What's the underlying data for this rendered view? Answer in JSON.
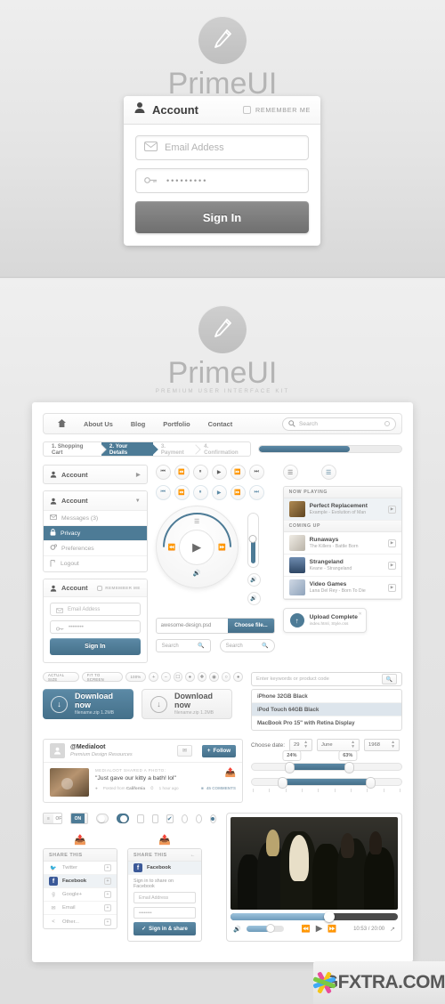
{
  "brand": {
    "name": "PrimeUI",
    "tagline": "PREMIUM USER INTERFACE KIT",
    "logo_icon": "pencil-icon",
    "accent_color": "#4d7b96",
    "grey_button_color": "#7f7f7f"
  },
  "login_hero": {
    "title": "Account",
    "account_icon": "user-icon",
    "remember_label": "REMEMBER ME",
    "email_placeholder": "Email Addess",
    "email_icon": "envelope-icon",
    "password_value": "•••••••••",
    "password_icon": "key-icon",
    "signin_label": "Sign In"
  },
  "nav": {
    "home_icon": "home-icon",
    "items": [
      "About Us",
      "Blog",
      "Portfolio",
      "Contact"
    ],
    "search_placeholder": "Search",
    "search_icon": "search-icon",
    "clear_icon": "close-circle-icon"
  },
  "checkout": {
    "steps": [
      {
        "label": "1. Shopping Cart",
        "state": "done"
      },
      {
        "label": "2. Your Details",
        "state": "active"
      },
      {
        "label": "3. Payment",
        "state": "todo"
      },
      {
        "label": "4. Confirmation",
        "state": "todo"
      }
    ],
    "progress_percent": 64
  },
  "accordion": {
    "collapsed_label": "Account",
    "expanded_label": "Account",
    "items": [
      {
        "label": "Messages (3)",
        "icon": "envelope-icon",
        "selected": false
      },
      {
        "label": "Privacy",
        "icon": "lock-icon",
        "selected": true
      },
      {
        "label": "Preferences",
        "icon": "gear-icon",
        "selected": false
      },
      {
        "label": "Logout",
        "icon": "exit-icon",
        "selected": false
      }
    ]
  },
  "login_small": {
    "title": "Account",
    "remember_label": "REMEMBER ME",
    "email_placeholder": "Email Addess",
    "password_value": "••••••••",
    "signin_label": "Sign In"
  },
  "transport": {
    "buttons": [
      "prev-track-icon",
      "rewind-icon",
      "pause-icon",
      "play-icon",
      "fast-forward-icon",
      "next-track-icon"
    ],
    "glyphs": [
      "⏮",
      "⏪",
      "⏸",
      "▶",
      "⏩",
      "⏭"
    ]
  },
  "clickwheel": {
    "menu_icon": "menu-list-icon",
    "prev_icon": "rewind-icon",
    "next_icon": "fast-forward-icon",
    "volume_icon": "volume-icon",
    "center_icon": "play-icon"
  },
  "volume": {
    "level_percent": 45,
    "speaker_icon": "volume-icon"
  },
  "view_toggles": [
    {
      "icon": "list-view-icon",
      "active": false
    },
    {
      "icon": "list-view-icon",
      "active": true
    }
  ],
  "playlist": {
    "now_playing_header": "NOW PLAYING",
    "coming_up_header": "COMING UP",
    "now_playing": {
      "title": "Perfect Replacement",
      "subtitle": "Example - Evolution of Man",
      "art_color": "#8a6b3f",
      "action_icon": "add-icon"
    },
    "coming_up": [
      {
        "title": "Runaways",
        "subtitle": "The Killers - Battle Born",
        "art_color": "#d8d4cd",
        "action_icon": "add-icon"
      },
      {
        "title": "Strangeland",
        "subtitle": "Keane - Strangeland",
        "art_color": "#4f6f93",
        "action_icon": "add-icon"
      },
      {
        "title": "Video Games",
        "subtitle": "Lana Del Rey - Born To Die",
        "art_color": "#9fb4c9",
        "action_icon": "add-icon"
      }
    ]
  },
  "file_upload": {
    "file_name": "awesome-design.psd",
    "file_icon": "document-icon",
    "choose_label": "Choose file...",
    "popup_title": "Upload Complete",
    "popup_subtitle": "index.html, Style.css",
    "popup_icon": "upload-arrow-icon",
    "popup_close_icon": "close-icon"
  },
  "searches": [
    {
      "placeholder": "Search",
      "shape": "square"
    },
    {
      "placeholder": "Search",
      "shape": "round"
    }
  ],
  "zoom_toolbar": {
    "actual_size": "ACTUAL SIZE",
    "fit_to_screen": "FIT TO SCREEN",
    "zoom_level": "100%",
    "buttons": [
      "+",
      "−",
      "☐",
      "●",
      "✚",
      "◉",
      "○",
      "●"
    ]
  },
  "downloads": [
    {
      "label": "Download now",
      "meta": "filename.zip 1.2MB",
      "style": "blue",
      "icon": "download-icon"
    },
    {
      "label": "Download now",
      "meta": "filename.zip 1.2MB",
      "style": "grey",
      "icon": "download-icon"
    }
  ],
  "autocomplete": {
    "placeholder": "Enter keywords or product code",
    "search_icon": "search-icon",
    "results": [
      {
        "label": "iPhone 32GB Black",
        "highlighted": false
      },
      {
        "label": "iPod Touch 64GB Black",
        "highlighted": true
      },
      {
        "label": "MacBook Pro 15\" with Retina Display",
        "highlighted": false
      }
    ]
  },
  "social": {
    "handle": "@Medialoot",
    "description": "Premium Design Resources",
    "message_icon": "envelope-icon",
    "follow_label": "Follow",
    "follow_icon": "plus-icon",
    "post_kicker": "MEDIALOOT SHARED A PHOTO:",
    "post_text": "\"Just gave our kitty a bath! lol\"",
    "location_prefix": "Posted from",
    "location": "California",
    "time_ago": "1 hour ago",
    "comments": "45 COMMENTS",
    "share_icon": "share-icon",
    "pin_icon": "pin-icon",
    "clock_icon": "clock-icon",
    "comment_icon": "comment-icon"
  },
  "date_picker": {
    "label": "Choose date:",
    "day": "29",
    "month": "June",
    "year": "1968"
  },
  "range_sliders": [
    {
      "low_label": "24%",
      "high_label": "63%",
      "low": 24,
      "high": 63,
      "show_tooltips": true
    },
    {
      "low_label": "",
      "high_label": "",
      "low": 20,
      "high": 78,
      "show_tooltips": false
    }
  ],
  "toggle_controls": {
    "switch_off_label": "OFF",
    "switch_on_label": "ON",
    "checkbox_check_glyph": "✔",
    "handle_glyph": "≡"
  },
  "share_widget": {
    "header": "SHARE THIS",
    "items": [
      {
        "label": "Twitter",
        "icon": "twitter-icon",
        "selected": false
      },
      {
        "label": "Facebook",
        "icon": "facebook-icon",
        "selected": true
      },
      {
        "label": "Google+",
        "icon": "googleplus-icon",
        "selected": false
      },
      {
        "label": "Email",
        "icon": "envelope-icon",
        "selected": false
      },
      {
        "label": "Other...",
        "icon": "share-nodes-icon",
        "selected": false
      }
    ],
    "share_top_icon": "share-icon"
  },
  "share_signin": {
    "header": "SHARE THIS",
    "back_icon": "arrow-left-icon",
    "network": "Facebook",
    "network_icon": "facebook-icon",
    "prompt": "Sign in to share on Facebook",
    "email_placeholder": "Email Address",
    "password_value": "••••••••",
    "button_label": "Sign in & share",
    "button_icon": "check-icon",
    "share_top_icon": "share-icon"
  },
  "video_player": {
    "time": "10:53 / 20:00",
    "progress_percent": 59,
    "volume_percent": 66,
    "volume_icon": "volume-icon",
    "rewind_icon": "rewind-icon",
    "play_icon": "play-icon",
    "forward_icon": "fast-forward-icon",
    "fullscreen_icon": "expand-icon"
  },
  "watermark": {
    "text": "GFXTRA.COM"
  }
}
